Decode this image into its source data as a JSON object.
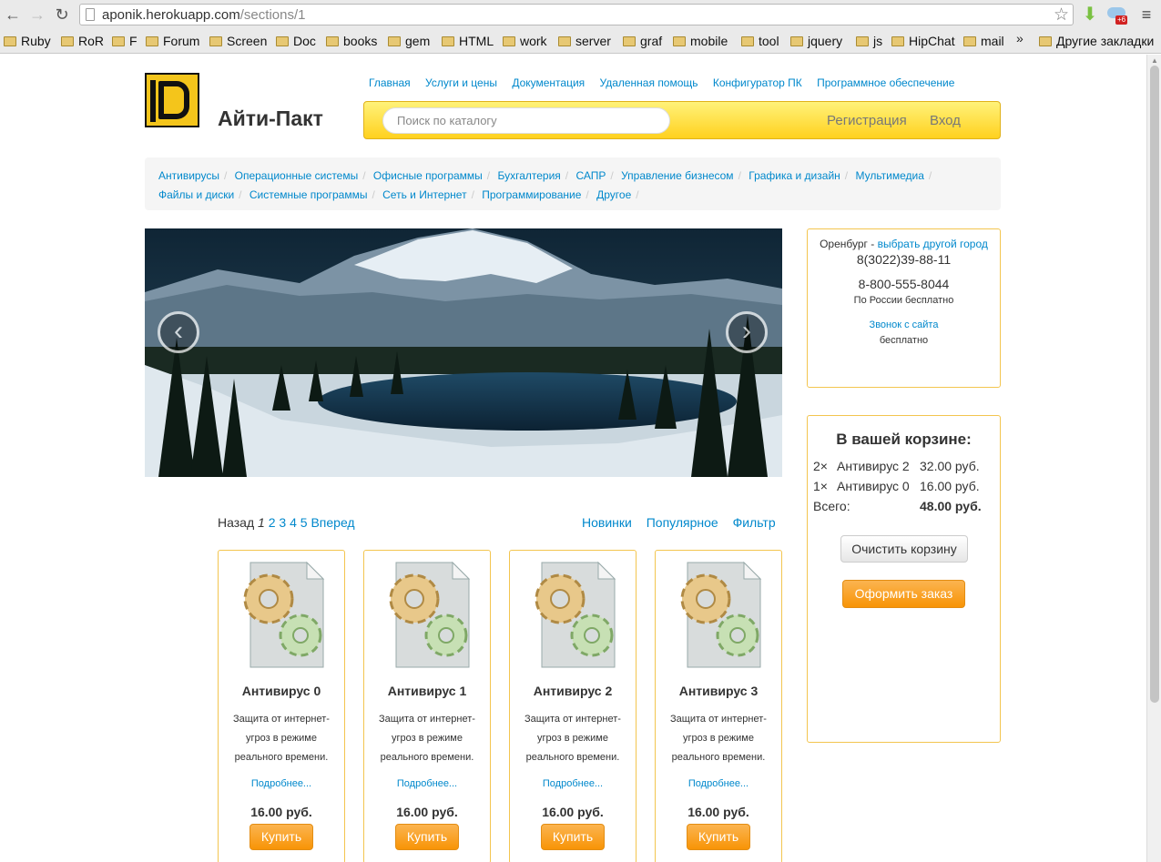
{
  "browser": {
    "url_host": "aponik.herokuapp.com",
    "url_path": "/sections/1",
    "ext_badge": "+6",
    "bookmarks": [
      "Ruby",
      "RoR",
      "F",
      "Forum",
      "Screen",
      "Doc",
      "books",
      "gem",
      "HTML",
      "work",
      "server",
      "graf",
      "mobile",
      "tool",
      "jquery",
      "js",
      "HipChat",
      "mail"
    ],
    "bookmarks_more": "»",
    "other_bookmarks": "Другие закладки"
  },
  "site": {
    "title": "Айти-Пакт",
    "logo_text": "ITPACT"
  },
  "topnav": [
    "Главная",
    "Услуги и цены",
    "Документация",
    "Удаленная помощь",
    "Конфигуратор ПК",
    "Программное обеспечение"
  ],
  "search": {
    "placeholder": "Поиск по каталогу"
  },
  "auth": {
    "register": "Регистрация",
    "login": "Вход"
  },
  "categories_row1": [
    "Антивирусы",
    "Операционные системы",
    "Офисные программы",
    "Бухгалтерия",
    "САПР",
    "Управление бизнесом",
    "Графика и дизайн",
    "Мультимедиа"
  ],
  "categories_row2": [
    "Файлы и диски",
    "Системные программы",
    "Сеть и Интернет",
    "Программирование",
    "Другое"
  ],
  "category_separator": "/",
  "slider": {
    "prev": "‹",
    "next": "›"
  },
  "contact": {
    "city": "Оренбург",
    "city_sep": " - ",
    "change_city": "выбрать другой город",
    "phone1": "8(3022)39-88-11",
    "phone2": "8-800-555-8044",
    "phone2_note": "По России бесплатно",
    "callback": "Звонок с сайта",
    "callback_note": "бесплатно"
  },
  "cart": {
    "title": "В вашей корзине:",
    "items": [
      {
        "qty": "2×",
        "name": "Антивирус 2",
        "price": "32.00 руб."
      },
      {
        "qty": "1×",
        "name": "Антивирус 0",
        "price": "16.00 руб."
      }
    ],
    "total_label": "Всего:",
    "total": "48.00 руб.",
    "clear_button": "Очистить корзину",
    "checkout_button": "Оформить заказ"
  },
  "pager": {
    "prev": "Назад",
    "current": "1",
    "pages": [
      "2",
      "3",
      "4",
      "5"
    ],
    "next": "Вперед"
  },
  "sort": [
    "Новинки",
    "Популярное",
    "Фильтр"
  ],
  "products": [
    {
      "name": "Антивирус 0",
      "desc": "Защита от интернет-угроз в режиме реального времени.",
      "more": "Подробнее...",
      "price": "16.00 руб.",
      "buy": "Купить"
    },
    {
      "name": "Антивирус 1",
      "desc": "Защита от интернет-угроз в режиме реального времени.",
      "more": "Подробнее...",
      "price": "16.00 руб.",
      "buy": "Купить"
    },
    {
      "name": "Антивирус 2",
      "desc": "Защита от интернет-угроз в режиме реального времени.",
      "more": "Подробнее...",
      "price": "16.00 руб.",
      "buy": "Купить"
    },
    {
      "name": "Антивирус 3",
      "desc": "Защита от интернет-угроз в режиме реального времени.",
      "more": "Подробнее...",
      "price": "16.00 руб.",
      "buy": "Купить"
    }
  ],
  "colors": {
    "link": "#0088cc",
    "accent_orange": "#f89406",
    "yellow_border": "#f3c54f"
  }
}
